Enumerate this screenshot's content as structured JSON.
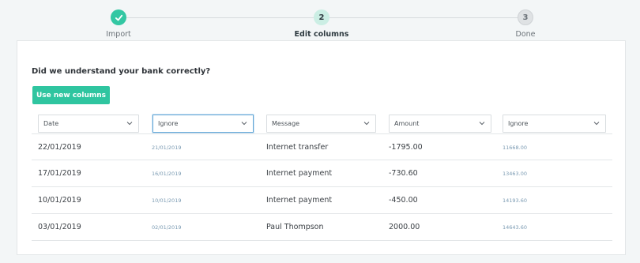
{
  "stepper": {
    "steps": [
      {
        "number": "1",
        "label": "Import",
        "state": "done"
      },
      {
        "number": "2",
        "label": "Edit columns",
        "state": "active"
      },
      {
        "number": "3",
        "label": "Done",
        "state": "todo"
      }
    ]
  },
  "colors": {
    "accent": "#2fc5a0",
    "background": "#f3f6f7",
    "focus_border": "#63a6d6"
  },
  "main": {
    "question": "Did we understand your bank correctly?",
    "use_button_label": "Use new columns"
  },
  "column_selects": [
    {
      "value": "Date"
    },
    {
      "value": "Ignore",
      "focused": true
    },
    {
      "value": "Message"
    },
    {
      "value": "Amount"
    },
    {
      "value": "Ignore"
    }
  ],
  "rows": [
    [
      "22/01/2019",
      "21/01/2019",
      "Internet transfer",
      "-1795.00",
      "11668.00"
    ],
    [
      "17/01/2019",
      "16/01/2019",
      "Internet payment",
      "-730.60",
      "13463.00"
    ],
    [
      "10/01/2019",
      "10/01/2019",
      "Internet payment",
      "-450.00",
      "14193.60"
    ],
    [
      "03/01/2019",
      "02/01/2019",
      "Paul Thompson",
      "2000.00",
      "14643.60"
    ]
  ]
}
